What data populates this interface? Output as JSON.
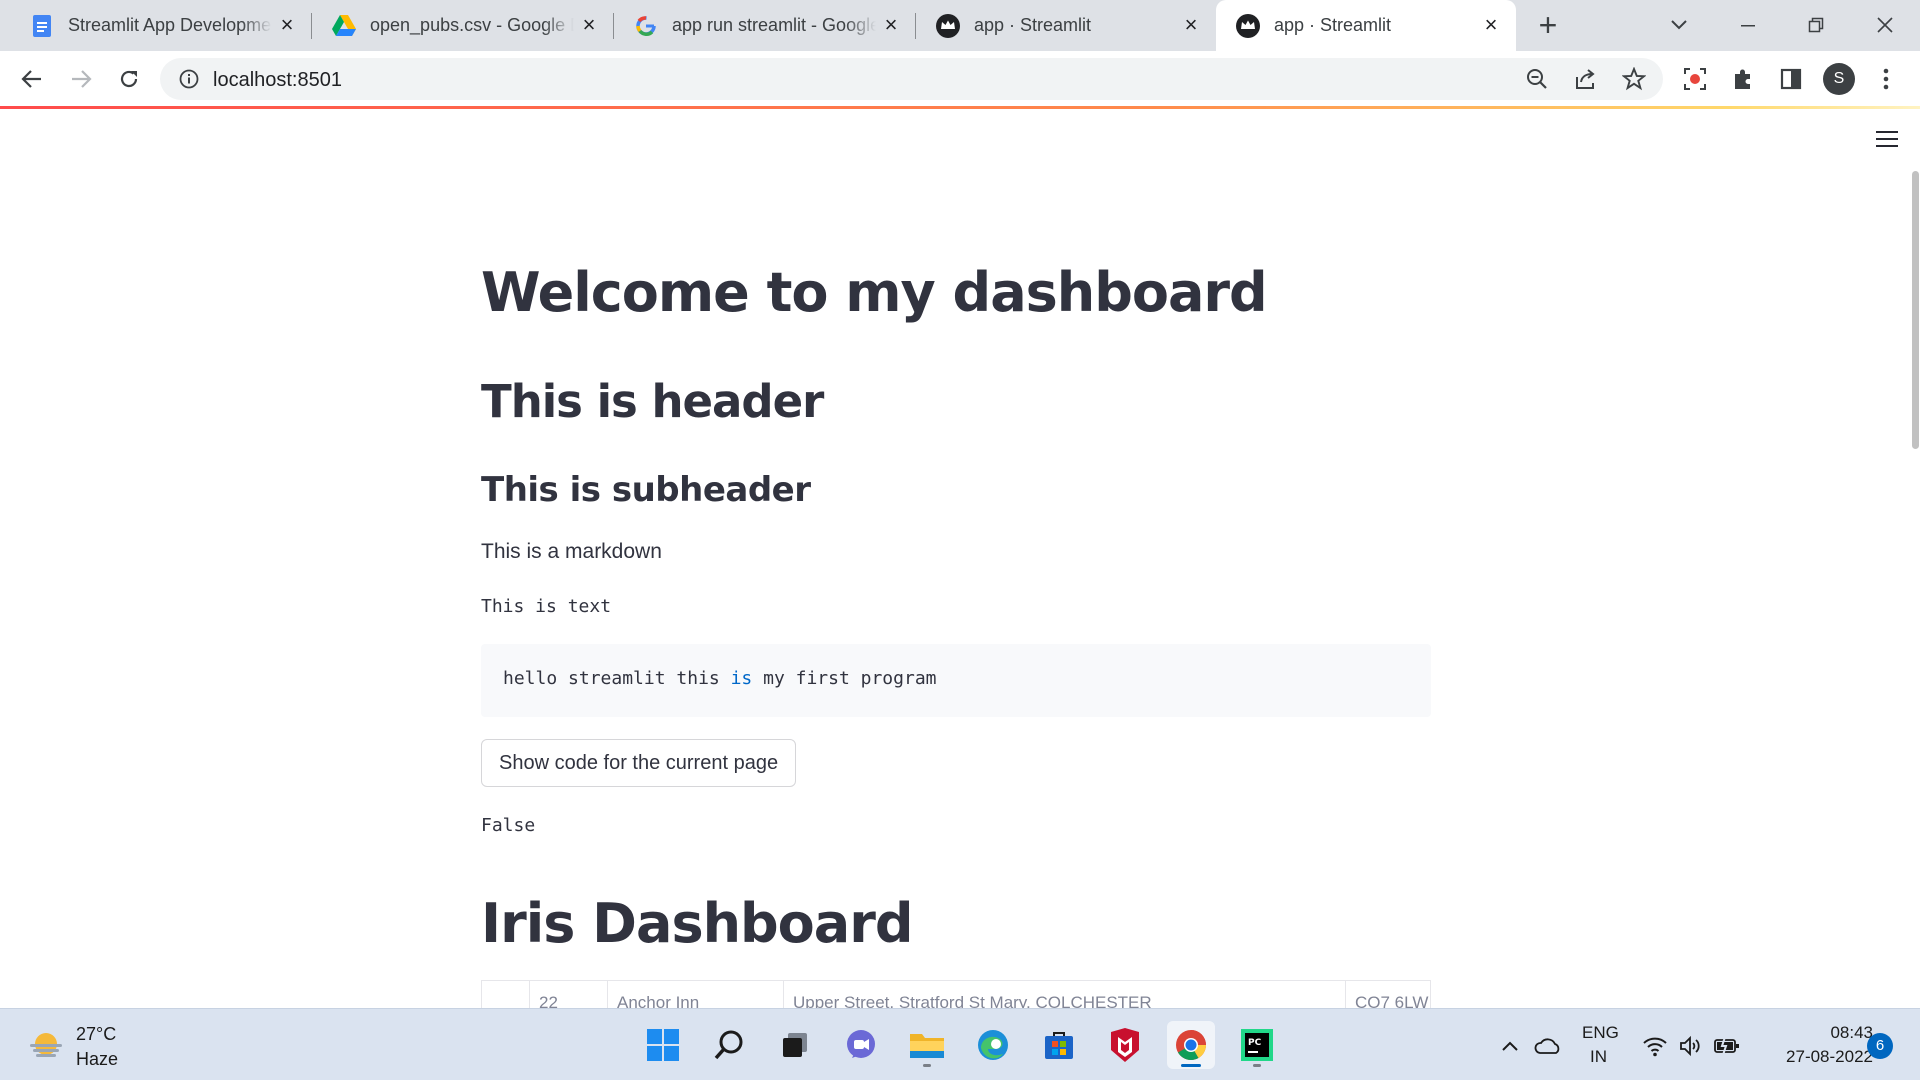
{
  "browser": {
    "tabs": [
      {
        "title": "Streamlit App Development",
        "favicon": "google-docs-icon",
        "active": false
      },
      {
        "title": "open_pubs.csv - Google Drive",
        "favicon": "google-drive-icon",
        "active": false
      },
      {
        "title": "app run streamlit - Google Search",
        "favicon": "google-icon",
        "active": false
      },
      {
        "title": "app · Streamlit",
        "favicon": "streamlit-crown-icon",
        "active": false
      },
      {
        "title": "app · Streamlit",
        "favicon": "streamlit-crown-icon",
        "active": true
      }
    ],
    "url": "localhost:8501",
    "profile_initial": "S"
  },
  "app": {
    "title": "Welcome to my dashboard",
    "header": "This is header",
    "subheader": "This is subheader",
    "markdown": "This is a markdown",
    "text": "This is text",
    "code": {
      "before": "hello streamlit this ",
      "keyword": "is",
      "after": " my first program"
    },
    "show_code_button": "Show code for the current page",
    "button_result": "False",
    "iris_title": "Iris Dashboard",
    "table_partial_row": [
      "",
      "22",
      "Anchor Inn",
      "Upper Street, Stratford St Mary, COLCHESTER",
      "CO7 6LW"
    ]
  },
  "taskbar": {
    "weather": {
      "temp": "27°C",
      "condition": "Haze"
    },
    "language": {
      "line1": "ENG",
      "line2": "IN"
    },
    "time": "08:43",
    "date": "27-08-2022",
    "notifications": "6"
  },
  "colors": {
    "streamlit_red": "#ff4b4b",
    "text": "#31333f",
    "code_keyword": "#0068c9",
    "windows_accent": "#0067c0"
  }
}
